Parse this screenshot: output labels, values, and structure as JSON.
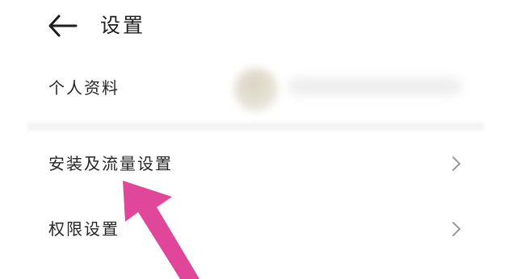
{
  "header": {
    "back_icon": "arrow-left-icon",
    "title": "设置"
  },
  "profile": {
    "label": "个人资料",
    "avatar": "blurred"
  },
  "menu": {
    "items": [
      {
        "label": "安装及流量设置",
        "icon": "chevron-right-icon"
      },
      {
        "label": "权限设置",
        "icon": "chevron-right-icon"
      }
    ]
  },
  "annotation": {
    "color": "#e0479b"
  }
}
